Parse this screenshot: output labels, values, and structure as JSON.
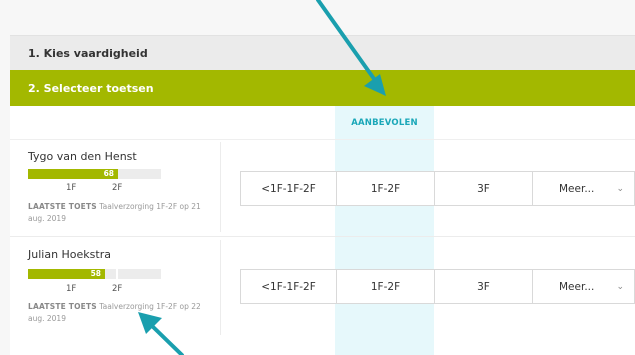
{
  "steps": {
    "step1_label": "1. Kies vaardigheid",
    "step2_label": "2. Selecteer toetsen"
  },
  "table": {
    "recommended_header": "AANBEVOLEN"
  },
  "students": [
    {
      "name": "Tygo van den Henst",
      "score": "68",
      "score_fraction": 0.68,
      "tick_labels": [
        "1F",
        "2F"
      ],
      "last_test_label": "LAATSTE TOETS",
      "last_test_text": "Taalverzorging 1F-2F op 21 aug. 2019",
      "options": [
        "<1F-1F-2F",
        "1F-2F",
        "3F",
        "Meer..."
      ]
    },
    {
      "name": "Julian Hoekstra",
      "score": "58",
      "score_fraction": 0.58,
      "tick_labels": [
        "1F",
        "2F"
      ],
      "last_test_label": "LAATSTE TOETS",
      "last_test_text": "Taalverzorging 1F-2F op 22 aug. 2019",
      "options": [
        "<1F-1F-2F",
        "1F-2F",
        "3F",
        "Meer..."
      ]
    }
  ],
  "colors": {
    "accent_green": "#a3b800",
    "recommended_bg": "#e6f8fb",
    "arrow_teal": "#1a9fae"
  },
  "icons": {
    "dropdown": "chevron-down-icon",
    "annotation": "arrow-icon"
  }
}
